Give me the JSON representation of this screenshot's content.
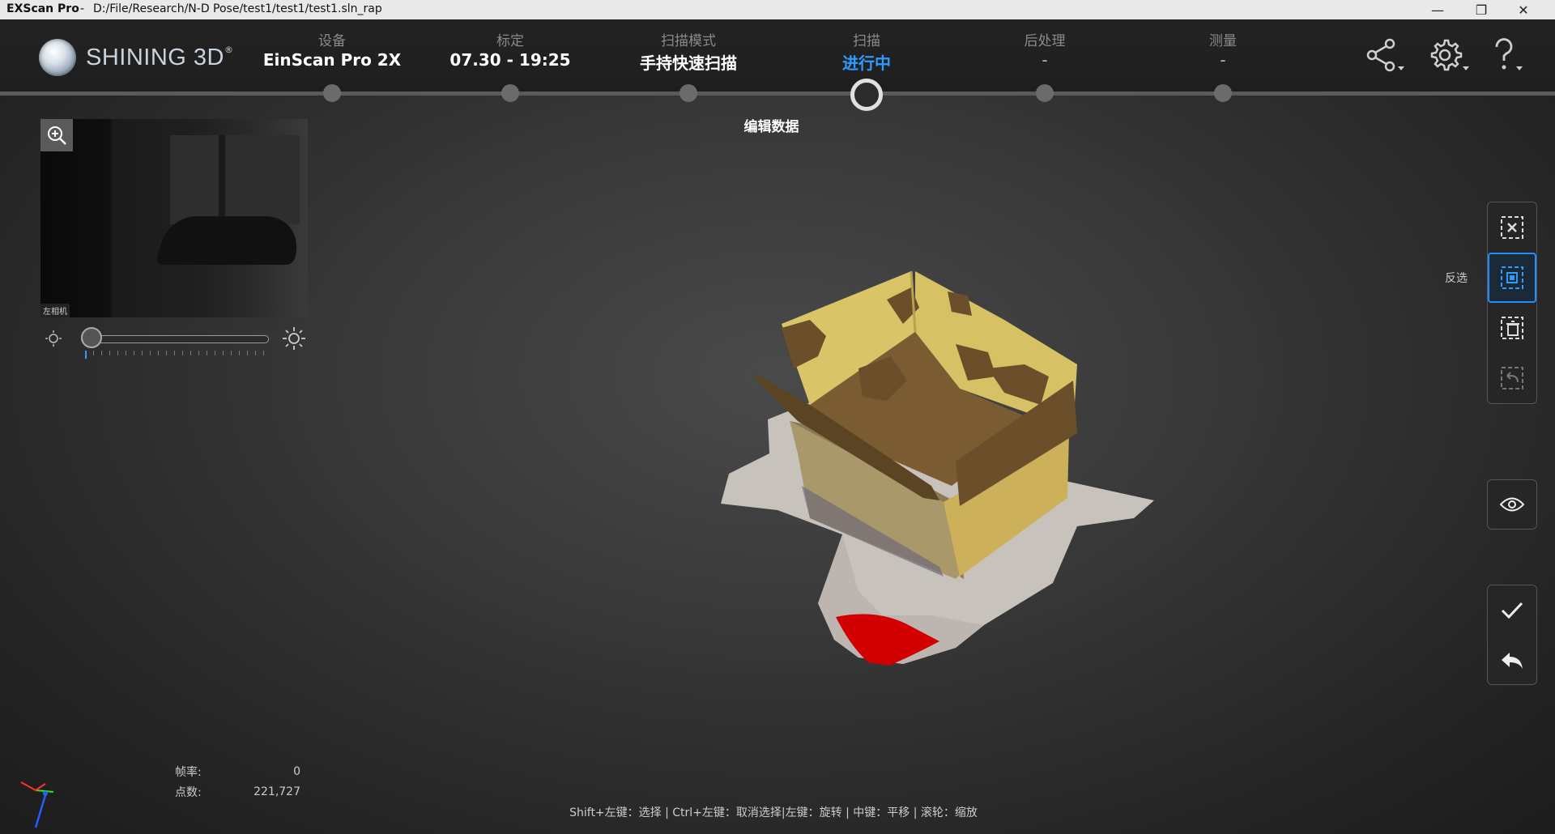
{
  "titlebar": {
    "app_name": "EXScan Pro",
    "separator": "-",
    "file_path": "D:/File/Research/N-D Pose/test1/test1/test1.sln_rap",
    "minimize": "—",
    "restore": "❐",
    "close": "✕"
  },
  "header": {
    "logo_text": "SHINING 3D",
    "logo_mark": "®",
    "steps": [
      {
        "label": "设备",
        "value": "EinScan Pro 2X"
      },
      {
        "label": "标定",
        "value": "07.30 - 19:25"
      },
      {
        "label": "扫描模式",
        "value": "手持快速扫描"
      },
      {
        "label": "扫描",
        "value": "进行中",
        "active": true
      },
      {
        "label": "后处理",
        "value": "-"
      },
      {
        "label": "测量",
        "value": "-"
      }
    ],
    "sub_label": "编辑数据",
    "icons": [
      "share-icon",
      "settings-icon",
      "help-icon"
    ]
  },
  "camera": {
    "label": "左相机",
    "brightness_fraction": 0.05
  },
  "toolbar": {
    "invert_label": "反选",
    "tools": [
      "clear-selection-icon",
      "invert-selection-icon",
      "delete-selection-icon",
      "undo-selection-icon"
    ],
    "view_tool": "eye-icon",
    "confirm_tools": [
      "check-icon",
      "back-icon"
    ]
  },
  "stats": {
    "frame_rate_label": "帧率:",
    "frame_rate_value": "0",
    "point_count_label": "点数:",
    "point_count_value": "221,727"
  },
  "hint": "Shift+左键：选择 | Ctrl+左键：取消选择|左键：旋转 | 中键：平移 | 滚轮：缩放",
  "colors": {
    "accent": "#2f9bff",
    "selection_red": "#d20000",
    "box_yellow": "#d9c568",
    "box_brown": "#6b4e2a",
    "mat": "#c9c3bd"
  }
}
